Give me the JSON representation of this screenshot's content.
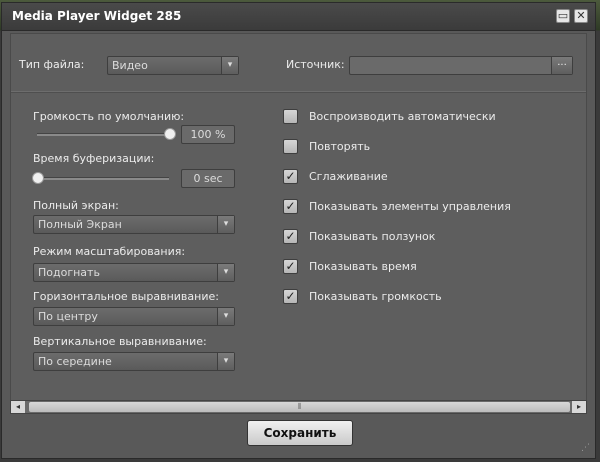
{
  "window": {
    "title": "Media Player Widget 285",
    "restore_glyph": "▭",
    "close_glyph": "✕"
  },
  "file_type": {
    "label": "Тип файла:",
    "value": "Видео"
  },
  "source": {
    "label": "Источник:",
    "value": "",
    "browse_label": "..."
  },
  "volume": {
    "label": "Громкость по умолчанию:",
    "level_percent": 100,
    "value_text": "100 %"
  },
  "buffer": {
    "label": "Время буферизации:",
    "level_fraction": 0,
    "value_text": "0 sec"
  },
  "fullscreen": {
    "label": "Полный экран:",
    "value": "Полный Экран"
  },
  "scale_mode": {
    "label": "Режим масштабирования:",
    "value": "Подогнать"
  },
  "h_align": {
    "label": "Горизонтальное выравнивание:",
    "value": "По центру"
  },
  "v_align": {
    "label": "Вертикальное выравнивание:",
    "value": "По середине"
  },
  "options": [
    {
      "label": "Воспроизводить автоматически",
      "checked": false
    },
    {
      "label": "Повторять",
      "checked": false
    },
    {
      "label": "Сглаживание",
      "checked": true
    },
    {
      "label": "Показывать элементы управления",
      "checked": true
    },
    {
      "label": "Показывать ползунок",
      "checked": true
    },
    {
      "label": "Показывать время",
      "checked": true
    },
    {
      "label": "Показывать громкость",
      "checked": true
    }
  ],
  "check_glyph": "✓",
  "dropdown_glyph": "▾",
  "scroll": {
    "left_glyph": "◂",
    "right_glyph": "▸",
    "thumb_glyph": "⦀"
  },
  "save_label": "Сохранить",
  "grip_glyph": "⋰"
}
